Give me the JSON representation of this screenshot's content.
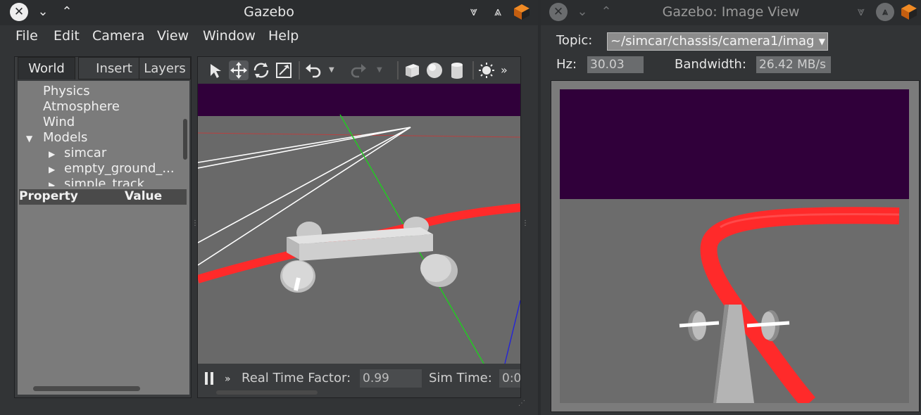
{
  "main_window": {
    "title": "Gazebo",
    "menus": [
      "File",
      "Edit",
      "Camera",
      "View",
      "Window",
      "Help"
    ],
    "tabs": [
      "World",
      "Insert",
      "Layers"
    ],
    "tree": {
      "items": [
        "Physics",
        "Atmosphere",
        "Wind",
        "Models"
      ],
      "models": [
        "simcar",
        "empty_ground_...",
        "simple_track"
      ]
    },
    "property_header": {
      "property": "Property",
      "value": "Value"
    },
    "toolbar_icons": [
      "select-arrow-icon",
      "translate-icon",
      "rotate-icon",
      "scale-icon",
      "undo-icon",
      "redo-icon",
      "box-icon",
      "sphere-icon",
      "cylinder-icon",
      "sun-light-icon"
    ],
    "toolbar_overflow": "»",
    "bottom": {
      "pause_icon": "pause-icon",
      "step_glyph": "»",
      "real_time_factor_label": "Real Time Factor:",
      "real_time_factor_value": "0.99",
      "sim_time_label": "Sim Time:",
      "sim_time_value": "0:0"
    }
  },
  "image_window": {
    "title": "Gazebo: Image View",
    "topic_label": "Topic:",
    "topic_value": "~/simcar/chassis/camera1/imag",
    "hz_label": "Hz:",
    "hz_value": "30.03",
    "bandwidth_label": "Bandwidth:",
    "bandwidth_value": "26.42 MB/s"
  },
  "colors": {
    "sky": "#30003a",
    "ground": "#696969",
    "track": "#ff2a2a",
    "panel_bg": "#7b7b7b",
    "titlebar": "#2b2d2f"
  }
}
